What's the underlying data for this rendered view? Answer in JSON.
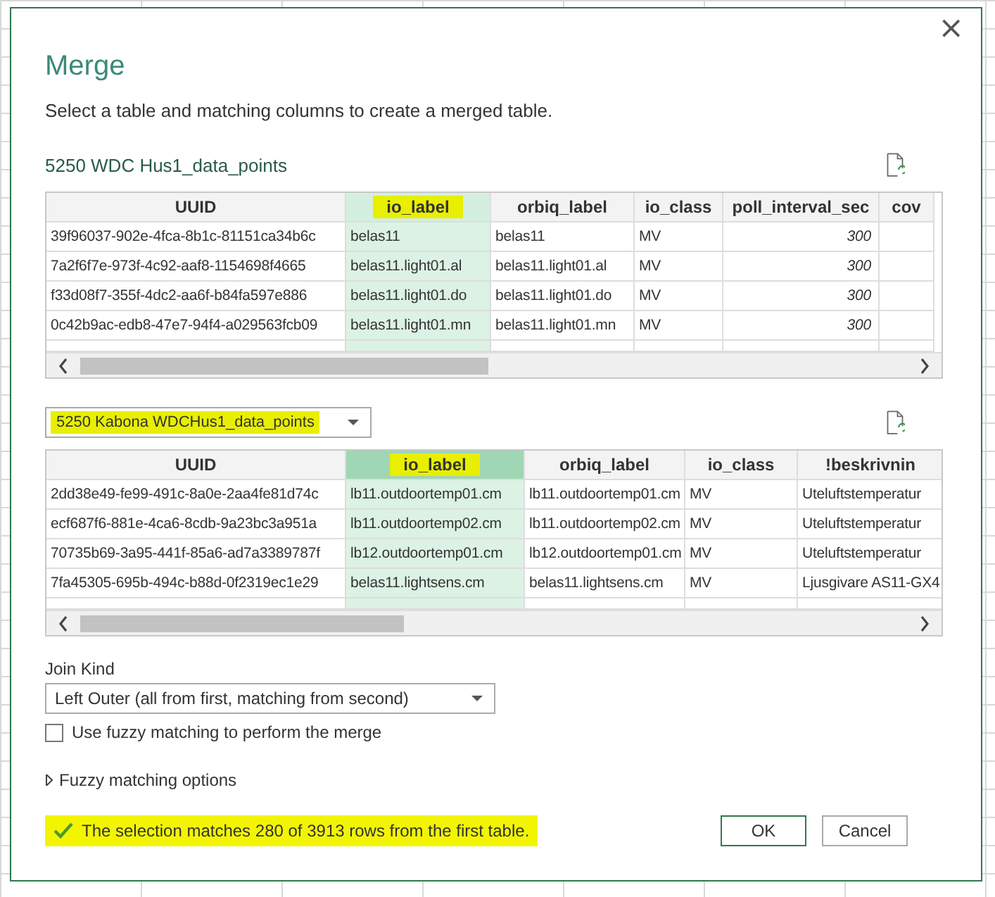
{
  "dialog": {
    "title": "Merge",
    "subtitle": "Select a table and matching columns to create a merged table.",
    "close": "×"
  },
  "first_table": {
    "name": "5250 WDC Hus1_data_points",
    "columns": [
      {
        "label": "UUID",
        "selected": false,
        "highlighted": false,
        "kind": "text"
      },
      {
        "label": "io_label",
        "selected": true,
        "highlighted": true,
        "kind": "text"
      },
      {
        "label": "orbiq_label",
        "selected": false,
        "highlighted": false,
        "kind": "text"
      },
      {
        "label": "io_class",
        "selected": false,
        "highlighted": false,
        "kind": "text"
      },
      {
        "label": "poll_interval_sec",
        "selected": false,
        "highlighted": false,
        "kind": "number"
      },
      {
        "label": "cov",
        "selected": false,
        "highlighted": false,
        "kind": "text"
      }
    ],
    "rows": [
      [
        "39f96037-902e-4fca-8b1c-81151ca34b6c",
        "belas11",
        "belas11",
        "MV",
        "300",
        ""
      ],
      [
        "7a2f6f7e-973f-4c92-aaf8-1154698f4665",
        "belas11.light01.al",
        "belas11.light01.al",
        "MV",
        "300",
        ""
      ],
      [
        "f33d08f7-355f-4dc2-aa6f-b84fa597e886",
        "belas11.light01.do",
        "belas11.light01.do",
        "MV",
        "300",
        ""
      ],
      [
        "0c42b9ac-edb8-47e7-94f4-a029563fcb09",
        "belas11.light01.mn",
        "belas11.light01.mn",
        "MV",
        "300",
        ""
      ]
    ]
  },
  "second_table": {
    "name": "5250 Kabona WDCHus1_data_points",
    "highlighted": true,
    "columns": [
      {
        "label": "UUID",
        "selected": false,
        "highlighted": false,
        "kind": "text"
      },
      {
        "label": "io_label",
        "selected": true,
        "highlighted": true,
        "kind": "text"
      },
      {
        "label": "orbiq_label",
        "selected": false,
        "highlighted": false,
        "kind": "text"
      },
      {
        "label": "io_class",
        "selected": false,
        "highlighted": false,
        "kind": "text"
      },
      {
        "label": "!beskrivnin",
        "selected": false,
        "highlighted": false,
        "kind": "text"
      }
    ],
    "rows": [
      [
        "2dd38e49-fe99-491c-8a0e-2aa4fe81d74c",
        "lb11.outdoortemp01.cm",
        "lb11.outdoortemp01.cm",
        "MV",
        "Uteluftstemperatur"
      ],
      [
        "ecf687f6-881e-4ca6-8cdb-9a23bc3a951a",
        "lb11.outdoortemp02.cm",
        "lb11.outdoortemp02.cm",
        "MV",
        "Uteluftstemperatur"
      ],
      [
        "70735b69-3a95-441f-85a6-ad7a3389787f",
        "lb12.outdoortemp01.cm",
        "lb12.outdoortemp01.cm",
        "MV",
        "Uteluftstemperatur"
      ],
      [
        "7fa45305-695b-494c-b88d-0f2319ec1e29",
        "belas11.lightsens.cm",
        "belas11.lightsens.cm",
        "MV",
        "Ljusgivare AS11-GX4"
      ]
    ]
  },
  "join_kind": {
    "label": "Join Kind",
    "value": "Left Outer (all from first, matching from second)"
  },
  "fuzzy": {
    "label": "Use fuzzy matching to perform the merge",
    "checked": false
  },
  "fuzzy_options": {
    "label": "Fuzzy matching options",
    "expanded": false
  },
  "status": {
    "text": "The selection matches 280 of 3913 rows from the first table.",
    "highlighted": true
  },
  "buttons": [
    {
      "label": "OK",
      "kind": "primary"
    },
    {
      "label": "Cancel",
      "kind": "secondary"
    }
  ]
}
